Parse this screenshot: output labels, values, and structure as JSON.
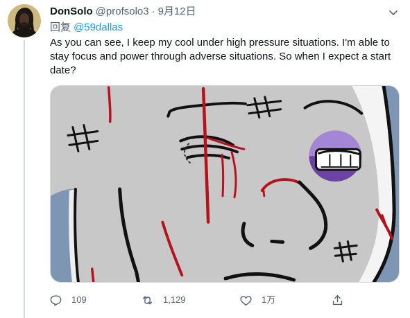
{
  "colors": {
    "text_primary": "#0f1419",
    "text_secondary": "#536471",
    "link": "#1d9bf0",
    "thread_line": "#cfd9de",
    "media_border": "#cfd9de"
  },
  "author": {
    "display_name": "DonSolo",
    "handle": "@profsolo3",
    "separator": "·",
    "date": "9月12日",
    "more_icon": "chevron-down-icon"
  },
  "reply_context": {
    "prefix": "回复",
    "mention": "@59dallas"
  },
  "tweet": {
    "text": "As you can see, I keep my cool under high pressure situations. I'm able to stay focus and power through adverse situations. So when I expect a start date?"
  },
  "actions": {
    "reply": {
      "icon": "reply-icon",
      "count": "109"
    },
    "retweet": {
      "icon": "retweet-icon",
      "count": "1,129"
    },
    "like": {
      "icon": "heart-icon",
      "count": "1万"
    },
    "share": {
      "icon": "share-icon"
    }
  }
}
